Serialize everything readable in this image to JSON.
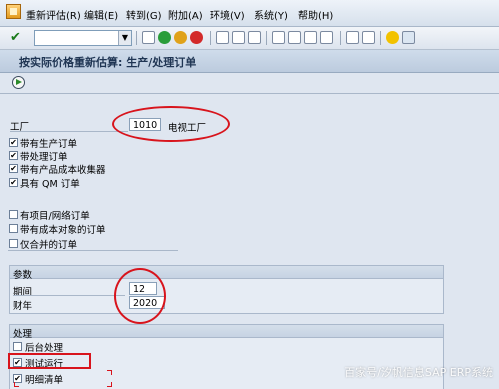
{
  "menu": {
    "items": [
      "重新评估(R)",
      "编辑(E)",
      "转到(G)",
      "附加(A)",
      "环境(V)",
      "系统(Y)",
      "帮助(H)"
    ]
  },
  "toolbar": {
    "command_value": ""
  },
  "page": {
    "title": "按实际价格重新估算: 生产/处理订单"
  },
  "selection": {
    "plant_label": "工厂",
    "plant_value": "1010",
    "plant_name": "电视工厂",
    "checks": [
      {
        "label": "带有生产订单",
        "checked": true
      },
      {
        "label": "带处理订单",
        "checked": true
      },
      {
        "label": "带有产品成本收集器",
        "checked": true
      },
      {
        "label": "具有 QM 订单",
        "checked": true
      },
      {
        "label": "有项目/网络订单",
        "checked": false
      },
      {
        "label": "带有成本对象的订单",
        "checked": false
      },
      {
        "label": "仅合并的订单",
        "checked": false
      }
    ]
  },
  "params": {
    "title": "参数",
    "period_label": "期间",
    "period_value": "12",
    "year_label": "财年",
    "year_value": "2020"
  },
  "processing": {
    "title": "处理",
    "checks": [
      {
        "label": "后台处理",
        "checked": false
      },
      {
        "label": "测试运行",
        "checked": true
      },
      {
        "label": "明细清单",
        "checked": true
      }
    ]
  },
  "watermark": "百家号/汐帆信息SAP ERP系统",
  "colors": {
    "annotation": "#d8141c",
    "accent_green": "#2b8a2b"
  }
}
